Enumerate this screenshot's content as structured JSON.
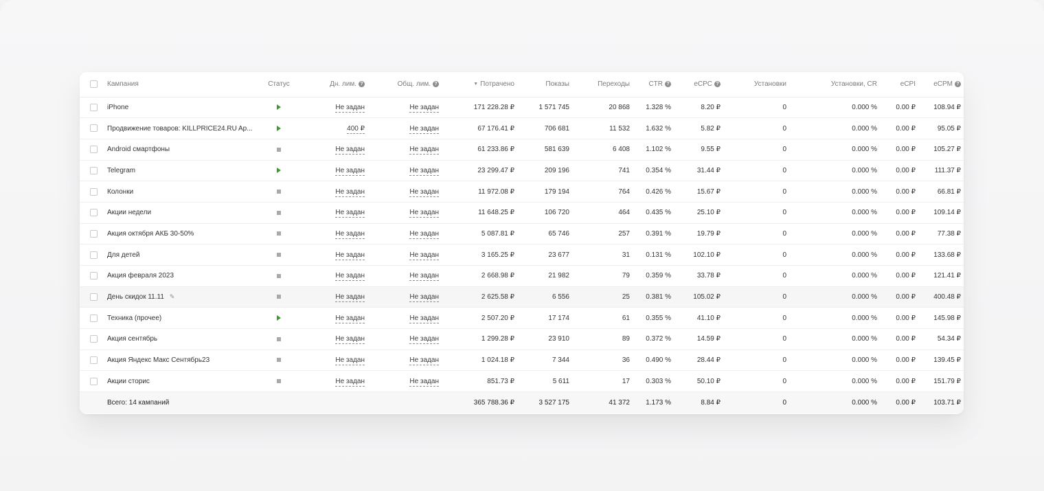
{
  "columns": {
    "campaign": "Кампания",
    "status": "Статус",
    "day_limit": "Дн. лим.",
    "total_limit": "Общ. лим.",
    "spent": "Потрачено",
    "impressions": "Показы",
    "clicks": "Переходы",
    "ctr": "CTR",
    "ecpc": "eCPC",
    "installs": "Установки",
    "installs_cr": "Установки, CR",
    "ecpi": "eCPI",
    "ecpm": "eCPM"
  },
  "rows": [
    {
      "name": "iPhone",
      "status": "play",
      "day_limit": "Не задан",
      "total_limit": "Не задан",
      "spent": "171 228.28 ₽",
      "impressions": "1 571 745",
      "clicks": "20 868",
      "ctr": "1.328 %",
      "ecpc": "8.20 ₽",
      "installs": "0",
      "installs_cr": "0.000 %",
      "ecpi": "0.00 ₽",
      "ecpm": "108.94 ₽"
    },
    {
      "name": "Продвижение товаров: KILLPRICE24.RU Ap...",
      "status": "play",
      "day_limit": "400 ₽",
      "total_limit": "Не задан",
      "spent": "67 176.41 ₽",
      "impressions": "706 681",
      "clicks": "11 532",
      "ctr": "1.632 %",
      "ecpc": "5.82 ₽",
      "installs": "0",
      "installs_cr": "0.000 %",
      "ecpi": "0.00 ₽",
      "ecpm": "95.05 ₽"
    },
    {
      "name": "Android смартфоны",
      "status": "pause",
      "day_limit": "Не задан",
      "total_limit": "Не задан",
      "spent": "61 233.86 ₽",
      "impressions": "581 639",
      "clicks": "6 408",
      "ctr": "1.102 %",
      "ecpc": "9.55 ₽",
      "installs": "0",
      "installs_cr": "0.000 %",
      "ecpi": "0.00 ₽",
      "ecpm": "105.27 ₽"
    },
    {
      "name": "Telegram",
      "status": "play",
      "day_limit": "Не задан",
      "total_limit": "Не задан",
      "spent": "23 299.47 ₽",
      "impressions": "209 196",
      "clicks": "741",
      "ctr": "0.354 %",
      "ecpc": "31.44 ₽",
      "installs": "0",
      "installs_cr": "0.000 %",
      "ecpi": "0.00 ₽",
      "ecpm": "111.37 ₽"
    },
    {
      "name": "Колонки",
      "status": "pause",
      "day_limit": "Не задан",
      "total_limit": "Не задан",
      "spent": "11 972.08 ₽",
      "impressions": "179 194",
      "clicks": "764",
      "ctr": "0.426 %",
      "ecpc": "15.67 ₽",
      "installs": "0",
      "installs_cr": "0.000 %",
      "ecpi": "0.00 ₽",
      "ecpm": "66.81 ₽"
    },
    {
      "name": "Акции недели",
      "status": "pause",
      "day_limit": "Не задан",
      "total_limit": "Не задан",
      "spent": "11 648.25 ₽",
      "impressions": "106 720",
      "clicks": "464",
      "ctr": "0.435 %",
      "ecpc": "25.10 ₽",
      "installs": "0",
      "installs_cr": "0.000 %",
      "ecpi": "0.00 ₽",
      "ecpm": "109.14 ₽"
    },
    {
      "name": "Акция октября АКБ 30-50%",
      "status": "pause",
      "day_limit": "Не задан",
      "total_limit": "Не задан",
      "spent": "5 087.81 ₽",
      "impressions": "65 746",
      "clicks": "257",
      "ctr": "0.391 %",
      "ecpc": "19.79 ₽",
      "installs": "0",
      "installs_cr": "0.000 %",
      "ecpi": "0.00 ₽",
      "ecpm": "77.38 ₽"
    },
    {
      "name": "Для детей",
      "status": "pause",
      "day_limit": "Не задан",
      "total_limit": "Не задан",
      "spent": "3 165.25 ₽",
      "impressions": "23 677",
      "clicks": "31",
      "ctr": "0.131 %",
      "ecpc": "102.10 ₽",
      "installs": "0",
      "installs_cr": "0.000 %",
      "ecpi": "0.00 ₽",
      "ecpm": "133.68 ₽"
    },
    {
      "name": "Акция февраля 2023",
      "status": "pause",
      "day_limit": "Не задан",
      "total_limit": "Не задан",
      "spent": "2 668.98 ₽",
      "impressions": "21 982",
      "clicks": "79",
      "ctr": "0.359 %",
      "ecpc": "33.78 ₽",
      "installs": "0",
      "installs_cr": "0.000 %",
      "ecpi": "0.00 ₽",
      "ecpm": "121.41 ₽"
    },
    {
      "name": "День скидок 11.11",
      "status": "pause",
      "day_limit": "Не задан",
      "total_limit": "Не задан",
      "spent": "2 625.58 ₽",
      "impressions": "6 556",
      "clicks": "25",
      "ctr": "0.381 %",
      "ecpc": "105.02 ₽",
      "installs": "0",
      "installs_cr": "0.000 %",
      "ecpi": "0.00 ₽",
      "ecpm": "400.48 ₽",
      "hover": true
    },
    {
      "name": "Техника (прочее)",
      "status": "play",
      "day_limit": "Не задан",
      "total_limit": "Не задан",
      "spent": "2 507.20 ₽",
      "impressions": "17 174",
      "clicks": "61",
      "ctr": "0.355 %",
      "ecpc": "41.10 ₽",
      "installs": "0",
      "installs_cr": "0.000 %",
      "ecpi": "0.00 ₽",
      "ecpm": "145.98 ₽"
    },
    {
      "name": "Акция сентябрь",
      "status": "pause",
      "day_limit": "Не задан",
      "total_limit": "Не задан",
      "spent": "1 299.28 ₽",
      "impressions": "23 910",
      "clicks": "89",
      "ctr": "0.372 %",
      "ecpc": "14.59 ₽",
      "installs": "0",
      "installs_cr": "0.000 %",
      "ecpi": "0.00 ₽",
      "ecpm": "54.34 ₽"
    },
    {
      "name": "Акция Яндекс Макс Сентябрь23",
      "status": "pause",
      "day_limit": "Не задан",
      "total_limit": "Не задан",
      "spent": "1 024.18 ₽",
      "impressions": "7 344",
      "clicks": "36",
      "ctr": "0.490 %",
      "ecpc": "28.44 ₽",
      "installs": "0",
      "installs_cr": "0.000 %",
      "ecpi": "0.00 ₽",
      "ecpm": "139.45 ₽"
    },
    {
      "name": "Акции сторис",
      "status": "pause",
      "day_limit": "Не задан",
      "total_limit": "Не задан",
      "spent": "851.73 ₽",
      "impressions": "5 611",
      "clicks": "17",
      "ctr": "0.303 %",
      "ecpc": "50.10 ₽",
      "installs": "0",
      "installs_cr": "0.000 %",
      "ecpi": "0.00 ₽",
      "ecpm": "151.79 ₽"
    }
  ],
  "totals": {
    "label": "Всего: 14 кампаний",
    "spent": "365 788.36 ₽",
    "impressions": "3 527 175",
    "clicks": "41 372",
    "ctr": "1.173 %",
    "ecpc": "8.84 ₽",
    "installs": "0",
    "installs_cr": "0.000 %",
    "ecpi": "0.00 ₽",
    "ecpm": "103.71 ₽"
  },
  "status_colors": {
    "play": "#3b9a2c",
    "pause": "#a9a9a9"
  },
  "icons": {
    "info": "info-icon",
    "sort": "sort-desc-icon",
    "edit": "pencil-icon"
  }
}
